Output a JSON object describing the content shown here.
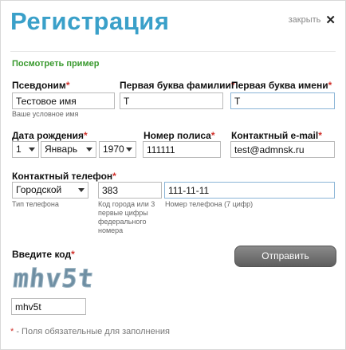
{
  "dialog": {
    "title": "Регистрация",
    "close_label": "закрыть",
    "close_icon": "✕"
  },
  "example_link": "Посмотреть пример",
  "fields": {
    "alias": {
      "label": "Псевдоним",
      "value": "Тестовое имя",
      "hint": "Ваше условное имя"
    },
    "last_initial": {
      "label": "Первая буква фамилии",
      "value": "Т"
    },
    "first_initial": {
      "label": "Первая буква имени",
      "value": "Т"
    },
    "birth_date": {
      "label": "Дата рождения",
      "day": "1",
      "month": "Январь",
      "year": "1970"
    },
    "policy_number": {
      "label": "Номер полиса",
      "value": "111111"
    },
    "email": {
      "label": "Контактный e-mail",
      "value": "test@admnsk.ru"
    },
    "phone": {
      "label": "Контактный телефон",
      "type_value": "Городской",
      "type_hint": "Тип телефона",
      "code_value": "383",
      "code_hint": "Код города или 3 первые цифры федерального номера",
      "number_value": "111-11-11",
      "number_hint": "Номер телефона (7 цифр)"
    },
    "captcha": {
      "label": "Введите код",
      "image_text": "mhv5t",
      "value": "mhv5t"
    }
  },
  "required_mark": "*",
  "submit_label": "Отправить",
  "footer": {
    "mark": "*",
    "text": " - Поля обязательные для заполнения"
  },
  "colors": {
    "title": "#3aa0c9",
    "link": "#3a9a2f",
    "required": "#d0302a",
    "captcha": "#6f8fa3"
  }
}
